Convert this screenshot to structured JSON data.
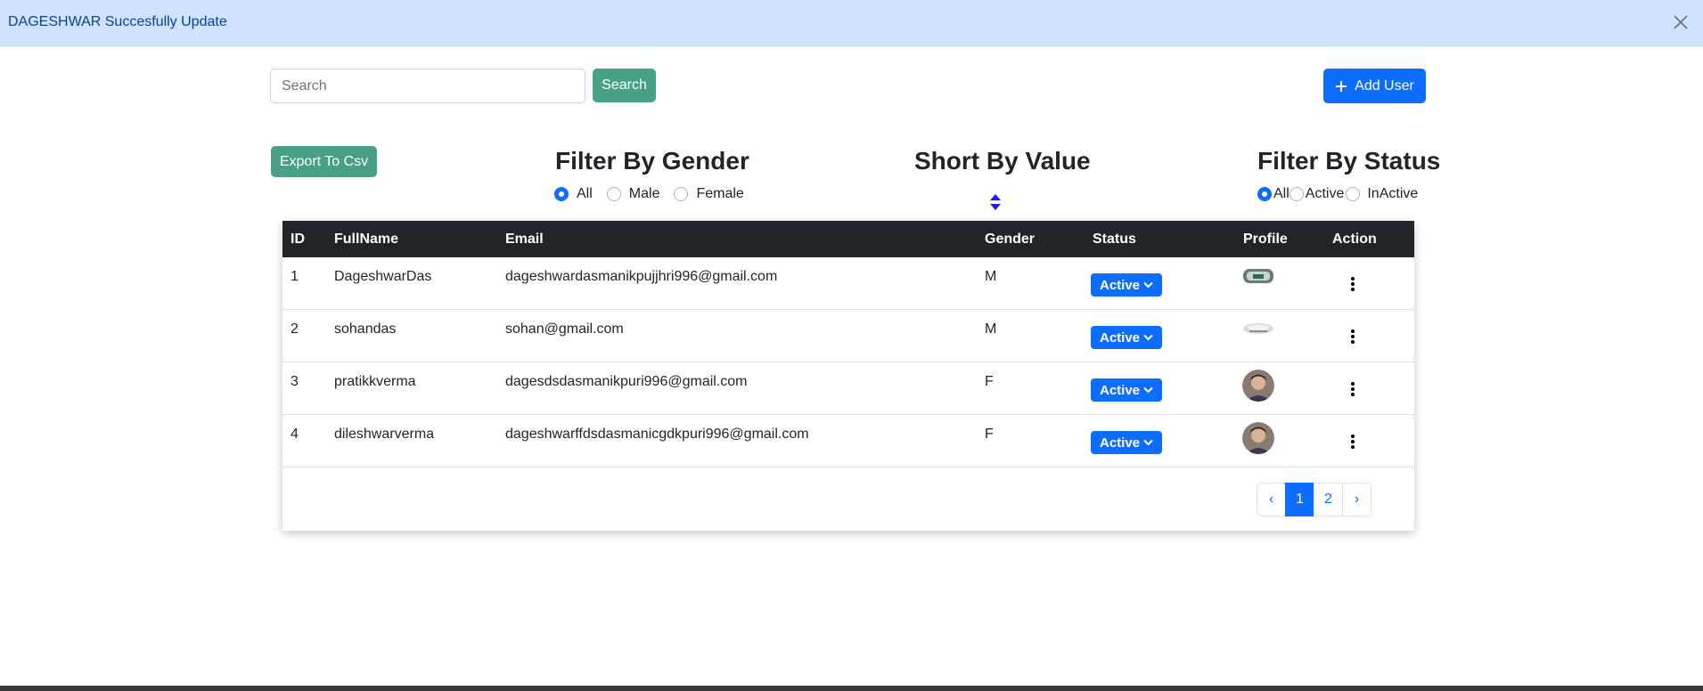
{
  "alert": {
    "message": "DAGESHWAR Succesfully Update"
  },
  "search": {
    "placeholder": "Search",
    "value": "",
    "button_label": "Search"
  },
  "toolbar": {
    "add_user_label": "Add User",
    "export_label": "Export To Csv"
  },
  "filters": {
    "gender": {
      "title": "Filter By Gender",
      "options": [
        "All",
        "Male",
        "Female"
      ],
      "selected": "All"
    },
    "sort": {
      "title": "Short By Value"
    },
    "status": {
      "title": "Filter By Status",
      "options": [
        "All",
        "Active",
        "InActive"
      ],
      "selected": "All"
    }
  },
  "table": {
    "headers": [
      "ID",
      "FullName",
      "Email",
      "Gender",
      "Status",
      "Profile",
      "Action"
    ],
    "rows": [
      {
        "id": "1",
        "fullname": "DageshwarDas",
        "email": "dageshwardasmanikpujjhri996@gmail.com",
        "gender": "M",
        "status": "Active",
        "profile": "banner"
      },
      {
        "id": "2",
        "fullname": "sohandas",
        "email": "sohan@gmail.com",
        "gender": "M",
        "status": "Active",
        "profile": "banner-light"
      },
      {
        "id": "3",
        "fullname": "pratikkverma",
        "email": "dagesdsdasmanikpuri996@gmail.com",
        "gender": "F",
        "status": "Active",
        "profile": "face"
      },
      {
        "id": "4",
        "fullname": "dileshwarverma",
        "email": "dageshwarffdsdasmanicgdkpuri996@gmail.com",
        "gender": "F",
        "status": "Active",
        "profile": "face"
      }
    ]
  },
  "pagination": {
    "prev": "‹",
    "pages": [
      "1",
      "2"
    ],
    "current": "1",
    "next": "›"
  },
  "colors": {
    "primary": "#0d6efd",
    "success_teal": "#48a088",
    "alert_bg": "#cfe2ff",
    "alert_text": "#084298",
    "table_head": "#212529"
  },
  "icons": {
    "close": "close-icon",
    "add": "plus-icon",
    "sort": "sort-icon",
    "dropdown": "chevron-down-icon",
    "action": "kebab-menu-icon"
  }
}
